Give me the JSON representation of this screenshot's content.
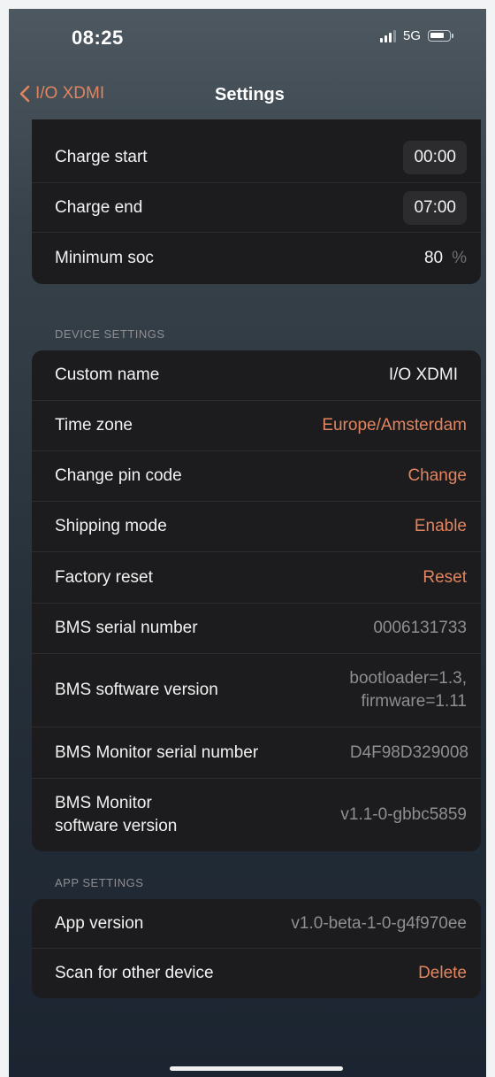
{
  "status": {
    "time": "08:25",
    "network": "5G"
  },
  "nav": {
    "back_label": "I/O XDMI",
    "title": "Settings"
  },
  "charge": {
    "rows": [
      {
        "label": "Charge start",
        "value": "00:00"
      },
      {
        "label": "Charge end",
        "value": "07:00"
      }
    ],
    "min_soc": {
      "label": "Minimum soc",
      "value": "80",
      "unit": "%"
    }
  },
  "device": {
    "header": "DEVICE SETTINGS",
    "rows": [
      {
        "label": "Custom name",
        "value": "I/O XDMI"
      },
      {
        "label": "Time zone",
        "value": "Europe/Amsterdam"
      },
      {
        "label": "Change pin code",
        "value": "Change"
      },
      {
        "label": "Shipping mode",
        "value": "Enable"
      },
      {
        "label": "Factory reset",
        "value": "Reset"
      },
      {
        "label": "BMS serial number",
        "value": "0006131733"
      },
      {
        "label": "BMS software version",
        "value_line1": "bootloader=1.3,",
        "value_line2": "firmware=1.11"
      },
      {
        "label": "BMS Monitor serial number",
        "value": "D4F98D329008"
      },
      {
        "label_line1": "BMS Monitor",
        "label_line2": "software version",
        "value": "v1.1-0-gbbc5859"
      }
    ]
  },
  "app": {
    "header": "APP SETTINGS",
    "rows": [
      {
        "label": "App version",
        "value": "v1.0-beta-1-0-g4f970ee"
      },
      {
        "label": "Scan for other device",
        "value": "Delete"
      }
    ]
  },
  "colors": {
    "accent": "#e1845f",
    "card": "#1c1c1e",
    "muted": "#8e8e93"
  }
}
